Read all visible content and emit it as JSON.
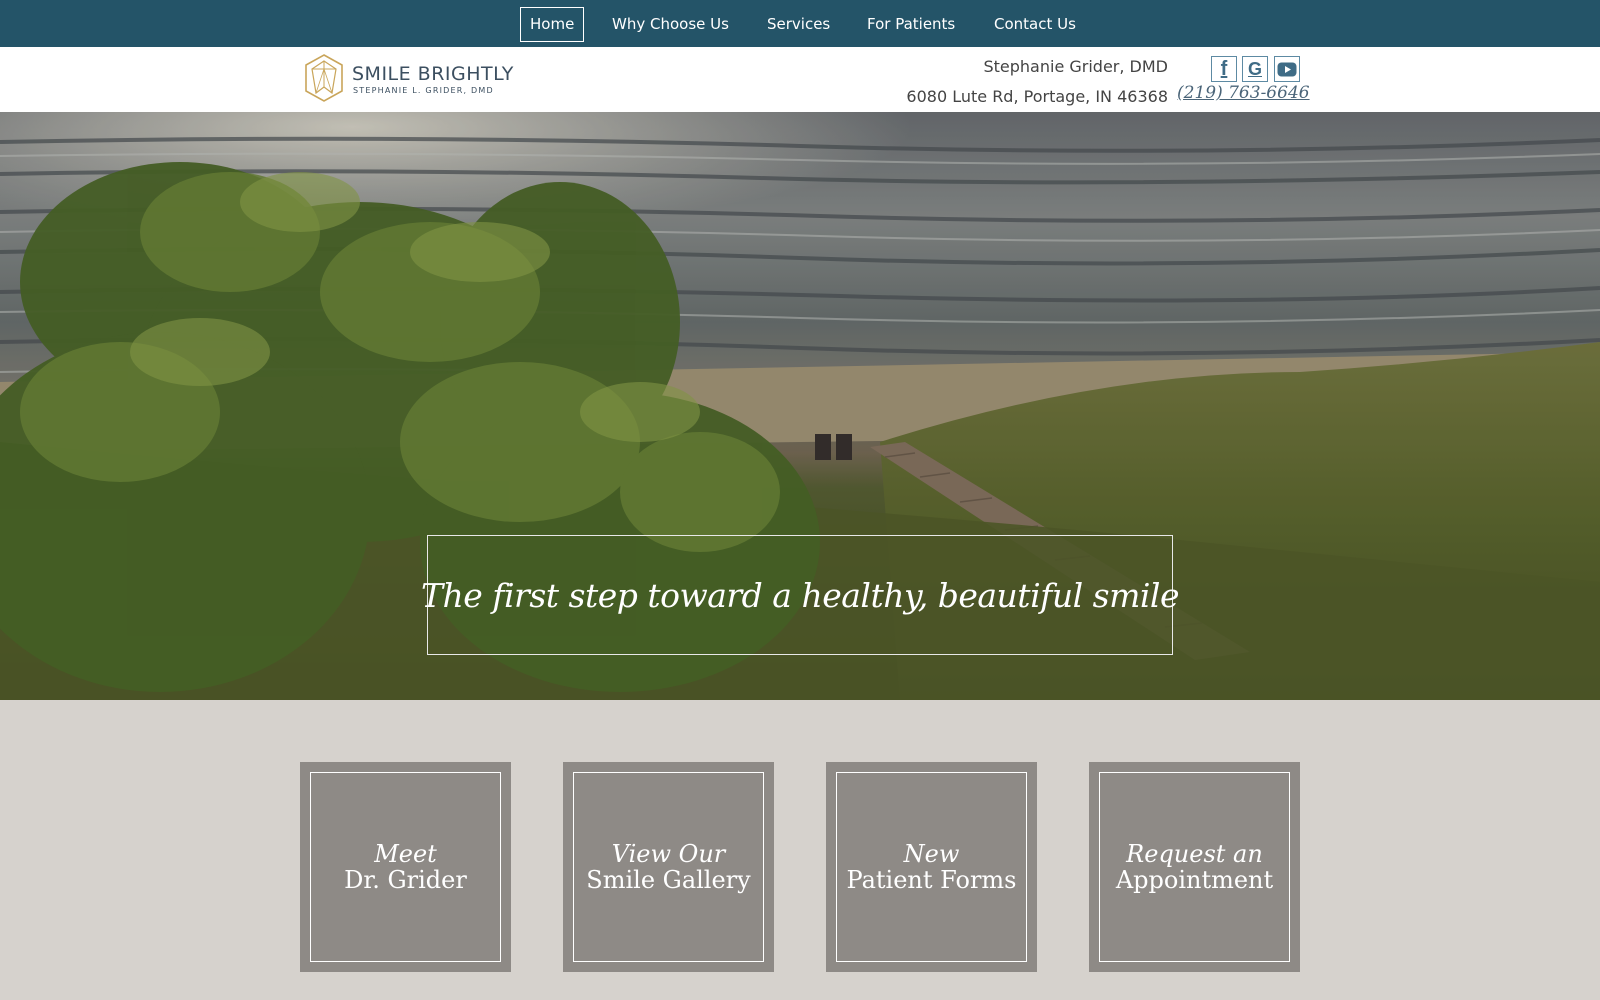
{
  "nav": {
    "items": [
      {
        "label": "Home",
        "active": true
      },
      {
        "label": "Why Choose Us",
        "active": false
      },
      {
        "label": "Services",
        "active": false
      },
      {
        "label": "For Patients",
        "active": false
      },
      {
        "label": "Contact Us",
        "active": false
      }
    ]
  },
  "header": {
    "logo_title": "SMILE BRIGHTLY",
    "logo_subtitle": "STEPHANIE L. GRIDER, DMD",
    "doctor": "Stephanie Grider, DMD",
    "address": "6080 Lute Rd, Portage, IN 46368",
    "phone": "(219) 763-6646",
    "social": [
      {
        "icon": "facebook-icon",
        "glyph": "f"
      },
      {
        "icon": "google-icon",
        "glyph": "G"
      },
      {
        "icon": "youtube-icon",
        "glyph": "▶"
      }
    ]
  },
  "hero": {
    "tagline": "The first step toward a healthy, beautiful smile"
  },
  "cards": [
    {
      "line1": "Meet",
      "line2": "Dr. Grider"
    },
    {
      "line1": "View Our",
      "line2": "Smile Gallery"
    },
    {
      "line1": "New",
      "line2": "Patient Forms"
    },
    {
      "line1": "Request an",
      "line2": "Appointment"
    }
  ],
  "colors": {
    "nav_bg": "#245468",
    "page_bg": "#d6d2cd",
    "card_bg": "#8e8a86",
    "logo_gold": "#c9a55a"
  }
}
